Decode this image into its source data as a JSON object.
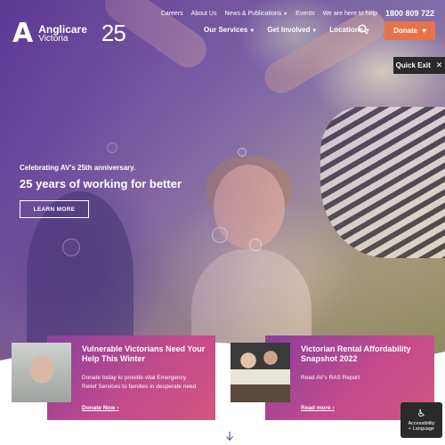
{
  "utility_nav": {
    "careers": "Careers",
    "about": "About Us",
    "news": "News & Publications",
    "events": "Events",
    "help_text": "We are here to help",
    "phone": "1800 809 722"
  },
  "logo": {
    "brand_line1": "Anglicare",
    "brand_line2": "Victoria",
    "anniversary": "25"
  },
  "main_nav": {
    "services": "Our Services",
    "involved": "Get Involved",
    "locations": "Locations",
    "donate": "Donate"
  },
  "quick_exit": "Quick Exit",
  "hero": {
    "subtitle": "Celebrating AV's 25th anniversary.",
    "title": "25 years of working for better",
    "cta": "LEARN MORE"
  },
  "cards": [
    {
      "title": "Vulnerable Victorians Need Your Help This Winter",
      "body": "Donate today to provide vital Emergency Relief Services to families in desperate need",
      "link": "Donate Now"
    },
    {
      "title": "Victorian Rental Affordability Snapshot 2022",
      "body": "Read AV's RAS Report",
      "link": "Read more"
    }
  ],
  "accessibility": {
    "line1": "Accessibility",
    "line2": "+ Language"
  },
  "colors": {
    "accent_orange": "#e8734a",
    "card_gradient_start": "#8a3f9c",
    "card_gradient_end": "#d2577e",
    "dark": "#2a2a2a"
  },
  "icons": [
    "search-icon",
    "heart-icon",
    "close-icon",
    "chevron-down-icon",
    "accessibility-icon",
    "arrow-down-icon",
    "arrow-right-icon"
  ]
}
